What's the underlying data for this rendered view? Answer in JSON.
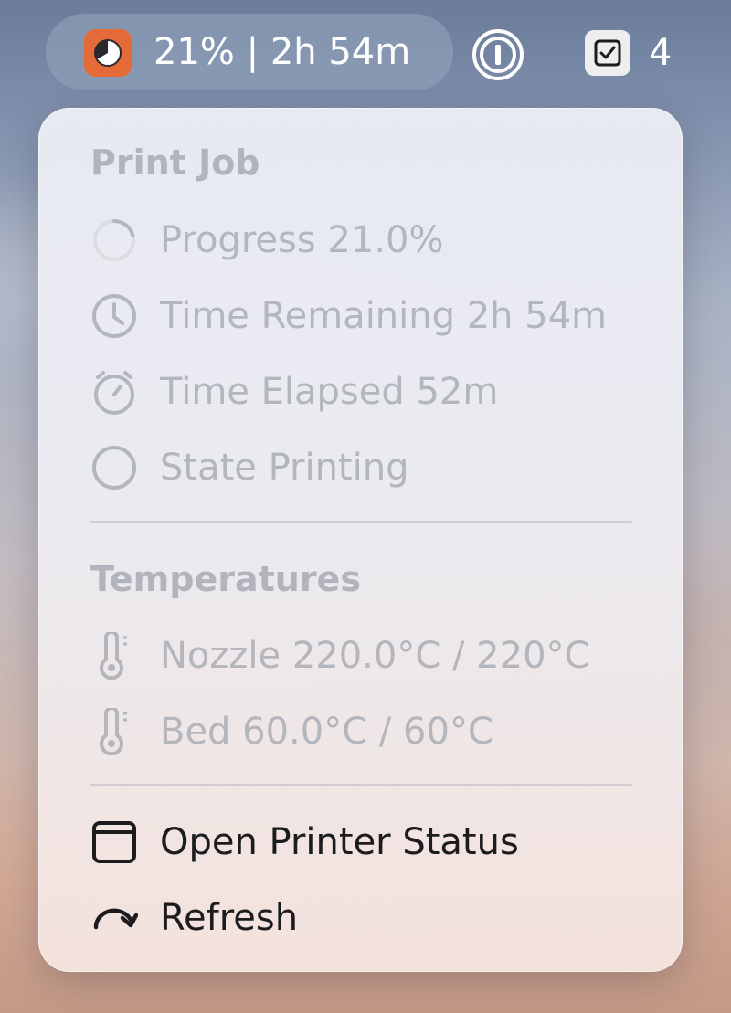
{
  "menubar": {
    "status_text": "21% | 2h 54m",
    "app_icon": "printer-app-icon",
    "password_icon": "one-password-icon",
    "tasks_icon": "checkbox-icon",
    "tasks_count": "4"
  },
  "menu": {
    "print_job": {
      "header": "Print Job",
      "items": [
        {
          "label": "Progress 21.0%",
          "icon": "progress-ring-icon"
        },
        {
          "label": "Time Remaining 2h 54m",
          "icon": "clock-icon"
        },
        {
          "label": "Time Elapsed 52m",
          "icon": "timer-icon"
        },
        {
          "label": "State Printing",
          "icon": "circle-icon"
        }
      ]
    },
    "temperatures": {
      "header": "Temperatures",
      "items": [
        {
          "label": "Nozzle 220.0°C / 220°C",
          "icon": "thermometer-icon"
        },
        {
          "label": "Bed 60.0°C / 60°C",
          "icon": "thermometer-icon"
        }
      ]
    },
    "actions": {
      "open_status": {
        "label": "Open Printer Status",
        "icon": "window-icon"
      },
      "refresh": {
        "label": "Refresh",
        "icon": "refresh-arrow-icon"
      }
    }
  },
  "colors": {
    "app_icon_bg": "#e46a38",
    "disabled_text": "#b4b6bd",
    "enabled_text": "#1c1c1f"
  },
  "progress_fraction": 0.21
}
